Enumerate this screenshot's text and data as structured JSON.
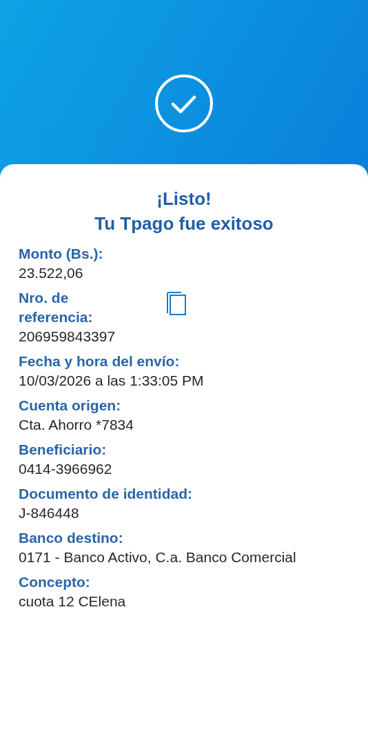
{
  "title": {
    "line_1": "¡Listo!",
    "line_2": "Tu Tpago fue exitoso"
  },
  "fields": [
    {
      "kind": "plain",
      "label": "Monto (Bs.):",
      "value": "23.522,06"
    },
    {
      "kind": "copyable",
      "label": "Nro. de referencia:",
      "value": "206959843397"
    },
    {
      "kind": "plain",
      "label": "Fecha y hora del envío:",
      "value": "10/03/2026 a las 1:33:05 PM"
    },
    {
      "kind": "plain",
      "label": "Cuenta origen:",
      "value": "Cta. Ahorro *7834"
    },
    {
      "kind": "plain",
      "label": "Beneficiario:",
      "value": "0414-3966962"
    },
    {
      "kind": "plain",
      "label": "Documento de identidad:",
      "value": "J-846448"
    },
    {
      "kind": "plain",
      "label": "Banco destino:",
      "value": "0171 - Banco Activo, C.a. Banco Comercial"
    },
    {
      "kind": "plain",
      "label": "Concepto:",
      "value": "cuota 12 CElena"
    }
  ]
}
